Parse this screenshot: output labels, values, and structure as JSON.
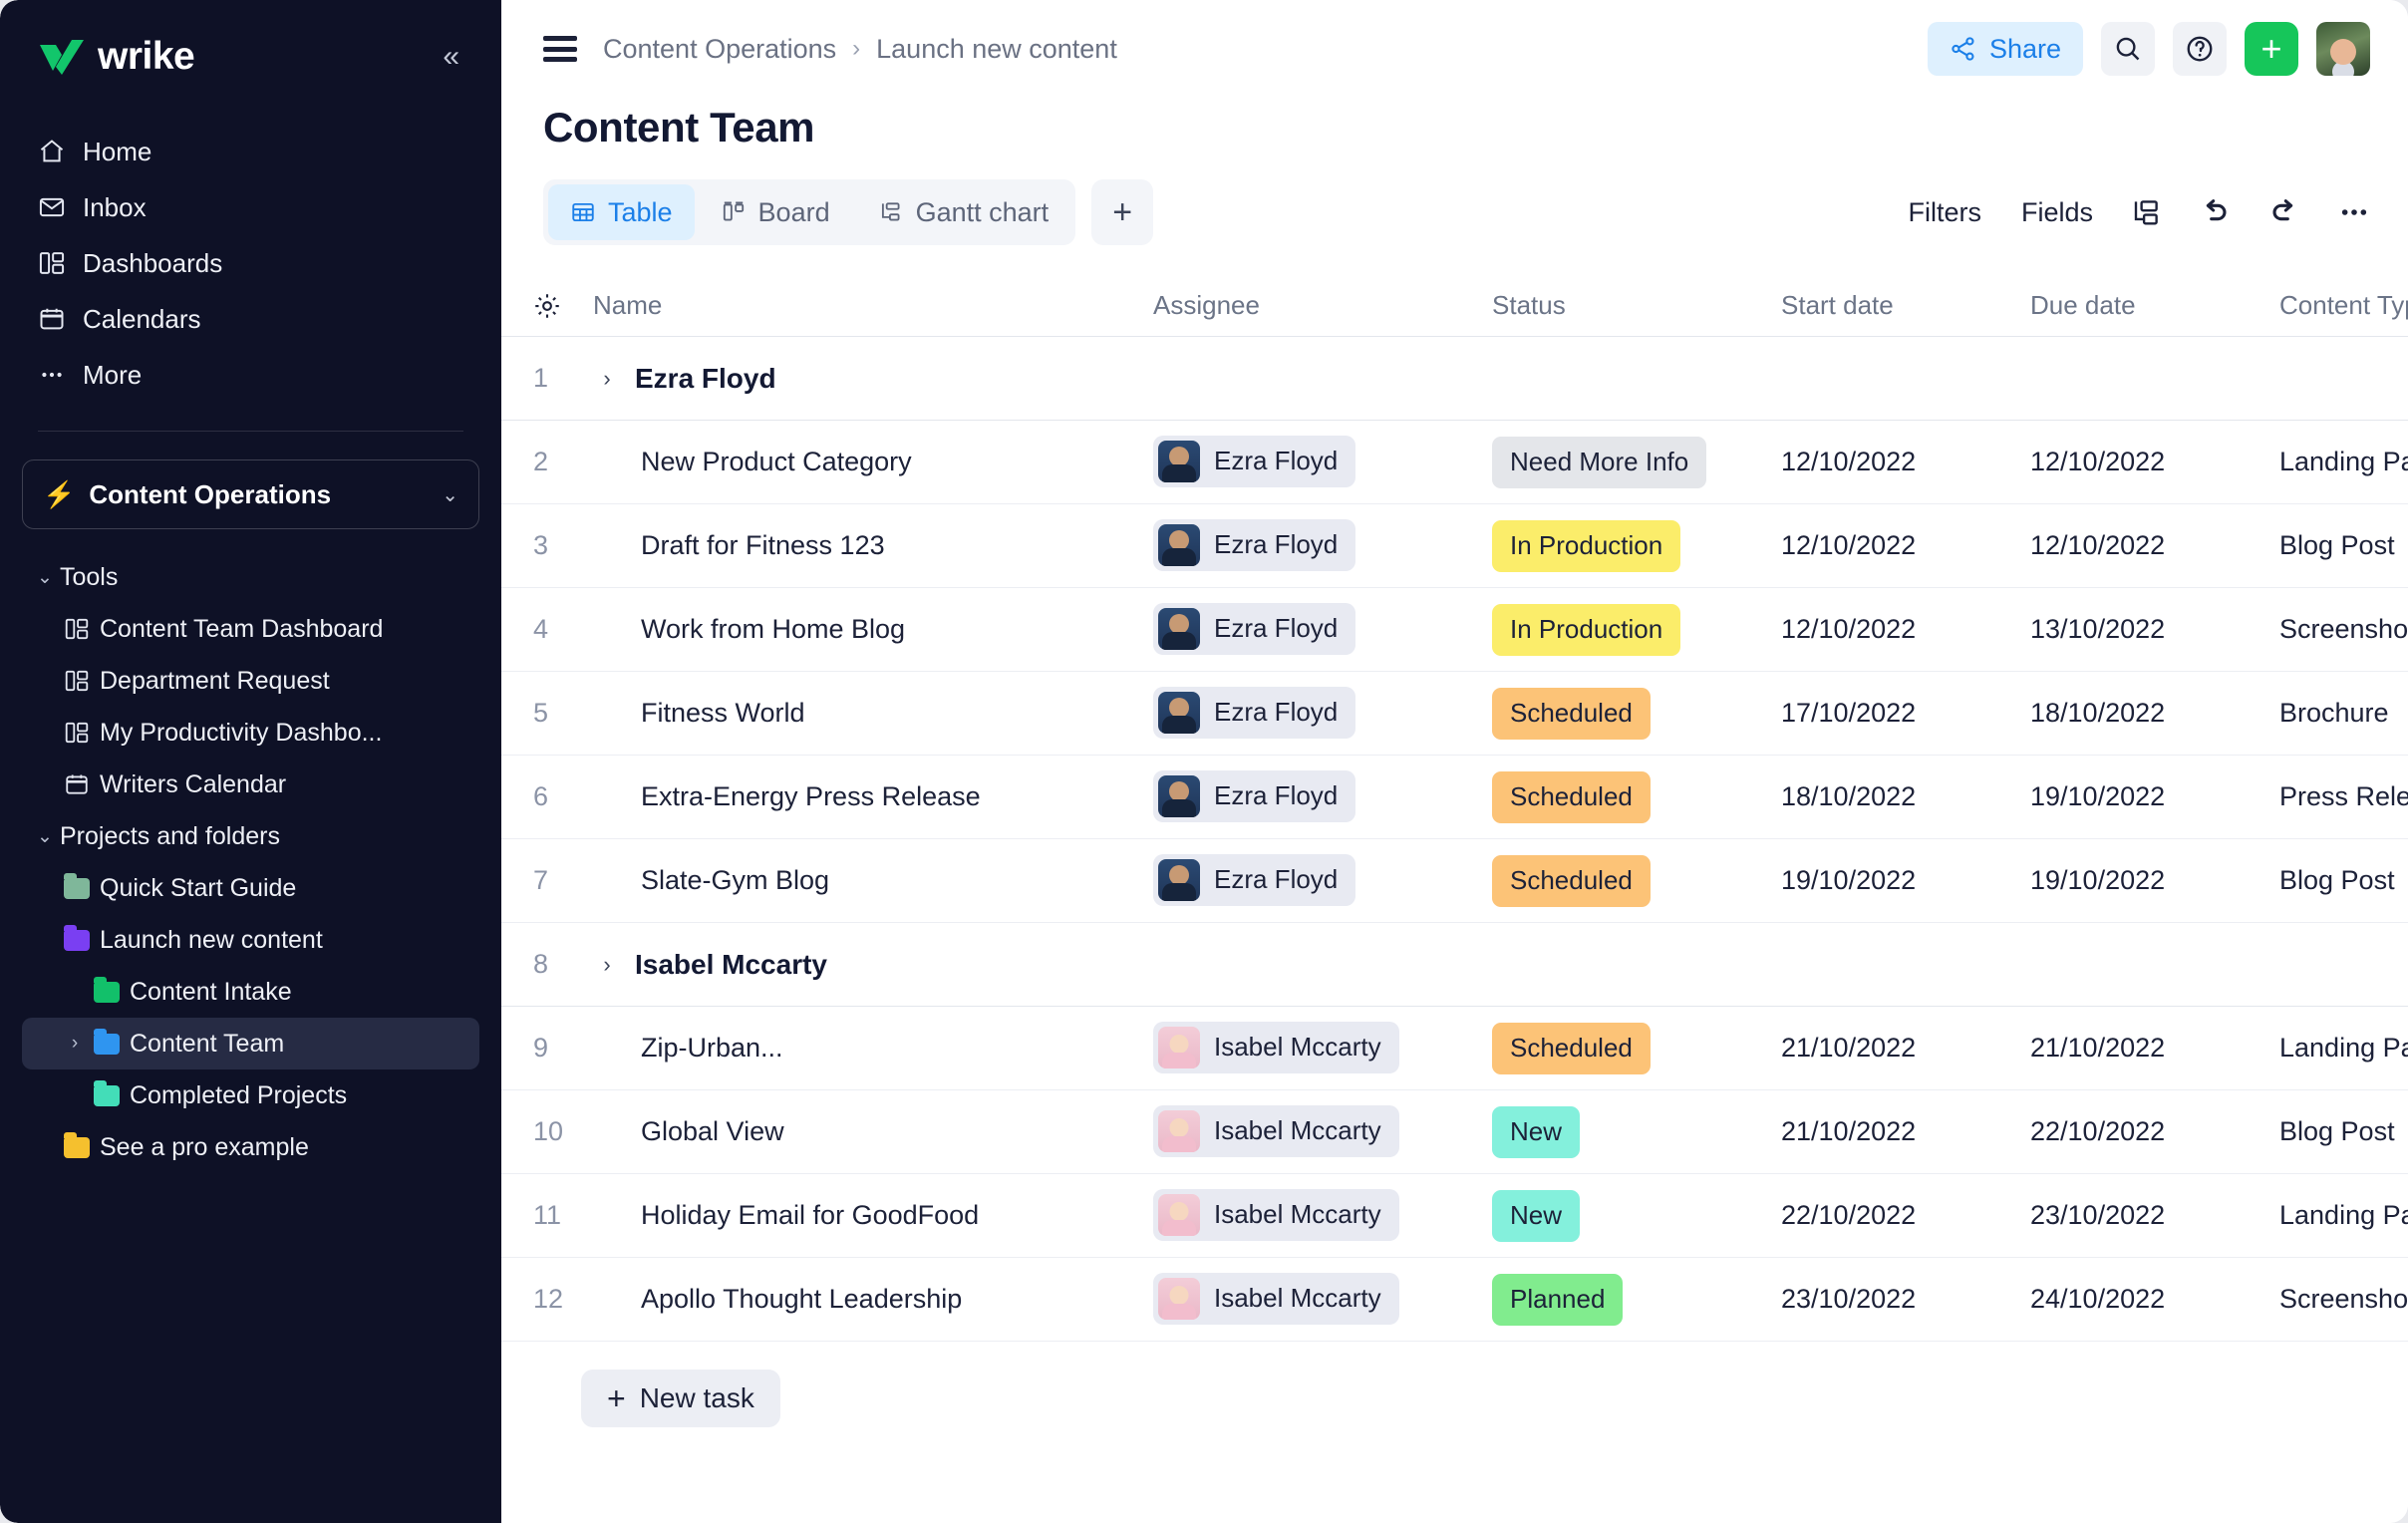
{
  "sidebar": {
    "brand": "wrike",
    "collapse_label": "«",
    "nav": [
      {
        "label": "Home",
        "icon": "home-icon"
      },
      {
        "label": "Inbox",
        "icon": "inbox-icon"
      },
      {
        "label": "Dashboards",
        "icon": "dashboards-icon"
      },
      {
        "label": "Calendars",
        "icon": "calendar-icon"
      },
      {
        "label": "More",
        "icon": "ellipsis-icon"
      }
    ],
    "space": {
      "label": "Content Operations",
      "icon": "bolt-icon",
      "chevron": "⌄"
    },
    "tools": {
      "label": "Tools",
      "chevron": "⌄",
      "items": [
        {
          "label": "Content Team Dashboard",
          "icon": "dashboard-icon"
        },
        {
          "label": "Department Request",
          "icon": "dashboard-icon"
        },
        {
          "label": "My Productivity Dashbo...",
          "icon": "dashboard-icon"
        },
        {
          "label": "Writers Calendar",
          "icon": "calendar-icon"
        }
      ]
    },
    "projects": {
      "label": "Projects and folders",
      "chevron": "⌄",
      "items": [
        {
          "label": "Quick Start Guide",
          "color": "#7fb79a",
          "level": 2,
          "selected": false,
          "twisty": ""
        },
        {
          "label": "Launch new content",
          "color": "#7a3ff2",
          "level": 2,
          "selected": false,
          "twisty": ""
        },
        {
          "label": "Content Intake",
          "color": "#12c06a",
          "level": 3,
          "selected": false,
          "twisty": ""
        },
        {
          "label": "Content Team",
          "color": "#2f95f0",
          "level": 3,
          "selected": true,
          "twisty": "›"
        },
        {
          "label": "Completed Projects",
          "color": "#43ddb8",
          "level": 3,
          "selected": false,
          "twisty": ""
        },
        {
          "label": "See a pro example",
          "color": "#f5c02e",
          "level": 2,
          "selected": false,
          "twisty": ""
        }
      ]
    }
  },
  "header": {
    "menu_icon": "hamburger-icon",
    "breadcrumb": [
      "Content Operations",
      "Launch new content"
    ],
    "breadcrumb_separator": "›",
    "share_label": "Share",
    "share_icon": "share-icon",
    "search_icon": "search-icon",
    "help_icon": "help-icon",
    "add_icon": "plus-icon",
    "avatar": "user-avatar"
  },
  "page": {
    "title": "Content Team"
  },
  "viewbar": {
    "tabs": [
      {
        "label": "Table",
        "icon": "table-icon",
        "active": true
      },
      {
        "label": "Board",
        "icon": "board-icon",
        "active": false
      },
      {
        "label": "Gantt chart",
        "icon": "gantt-icon",
        "active": false
      }
    ],
    "add_tab": "+",
    "filters_label": "Filters",
    "fields_label": "Fields",
    "icons": [
      "subtasks-icon",
      "undo-icon",
      "redo-icon",
      "more-icon"
    ]
  },
  "table": {
    "settings_icon": "gear-icon",
    "columns": [
      "Name",
      "Assignee",
      "Status",
      "Start date",
      "Due date",
      "Content Type"
    ],
    "rows": [
      {
        "num": "1",
        "type": "group",
        "name": "Ezra Floyd",
        "twisty": "›"
      },
      {
        "num": "2",
        "type": "task",
        "name": "New Product Category",
        "assignee": "Ezra Floyd",
        "avatar": "ezra",
        "status": "Need More Info",
        "status_color": "#e4e6ea",
        "start": "12/10/2022",
        "due": "12/10/2022",
        "content_type": "Landing Page"
      },
      {
        "num": "3",
        "type": "task",
        "name": "Draft for Fitness 123",
        "assignee": "Ezra Floyd",
        "avatar": "ezra",
        "status": "In Production",
        "status_color": "#fbed6a",
        "start": "12/10/2022",
        "due": "12/10/2022",
        "content_type": "Blog Post"
      },
      {
        "num": "4",
        "type": "task",
        "name": "Work from Home Blog",
        "assignee": "Ezra Floyd",
        "avatar": "ezra",
        "status": "In Production",
        "status_color": "#fbed6a",
        "start": "12/10/2022",
        "due": "13/10/2022",
        "content_type": "Screenshot"
      },
      {
        "num": "5",
        "type": "task",
        "name": "Fitness World",
        "assignee": "Ezra Floyd",
        "avatar": "ezra",
        "status": "Scheduled",
        "status_color": "#fcc377",
        "start": "17/10/2022",
        "due": "18/10/2022",
        "content_type": "Brochure"
      },
      {
        "num": "6",
        "type": "task",
        "name": "Extra-Energy Press Release",
        "assignee": "Ezra Floyd",
        "avatar": "ezra",
        "status": "Scheduled",
        "status_color": "#fcc377",
        "start": "18/10/2022",
        "due": "19/10/2022",
        "content_type": "Press Release"
      },
      {
        "num": "7",
        "type": "task",
        "name": "Slate-Gym Blog",
        "assignee": "Ezra Floyd",
        "avatar": "ezra",
        "status": "Scheduled",
        "status_color": "#fcc377",
        "start": "19/10/2022",
        "due": "19/10/2022",
        "content_type": "Blog Post"
      },
      {
        "num": "8",
        "type": "group",
        "name": "Isabel Mccarty",
        "twisty": "›"
      },
      {
        "num": "9",
        "type": "task",
        "name": "Zip-Urban...",
        "assignee": "Isabel Mccarty",
        "avatar": "isabel",
        "status": "Scheduled",
        "status_color": "#fcc377",
        "start": "21/10/2022",
        "due": "21/10/2022",
        "content_type": "Landing Page"
      },
      {
        "num": "10",
        "type": "task",
        "name": "Global View",
        "assignee": "Isabel Mccarty",
        "avatar": "isabel",
        "status": "New",
        "status_color": "#84f0dc",
        "start": "21/10/2022",
        "due": "22/10/2022",
        "content_type": "Blog Post"
      },
      {
        "num": "11",
        "type": "task",
        "name": "Holiday Email for GoodFood",
        "assignee": "Isabel Mccarty",
        "avatar": "isabel",
        "status": "New",
        "status_color": "#84f0dc",
        "start": "22/10/2022",
        "due": "23/10/2022",
        "content_type": "Landing Page"
      },
      {
        "num": "12",
        "type": "task",
        "name": "Apollo Thought Leadership",
        "assignee": "Isabel Mccarty",
        "avatar": "isabel",
        "status": "Planned",
        "status_color": "#81ec8e",
        "start": "23/10/2022",
        "due": "24/10/2022",
        "content_type": "Screenshot"
      }
    ],
    "new_task_label": "New task",
    "new_task_plus": "+"
  },
  "colors": {
    "sidebar_bg": "#0e1126",
    "accent_blue": "#1b7fe8",
    "accent_green": "#16c65a",
    "brand_green": "#12c66b"
  }
}
